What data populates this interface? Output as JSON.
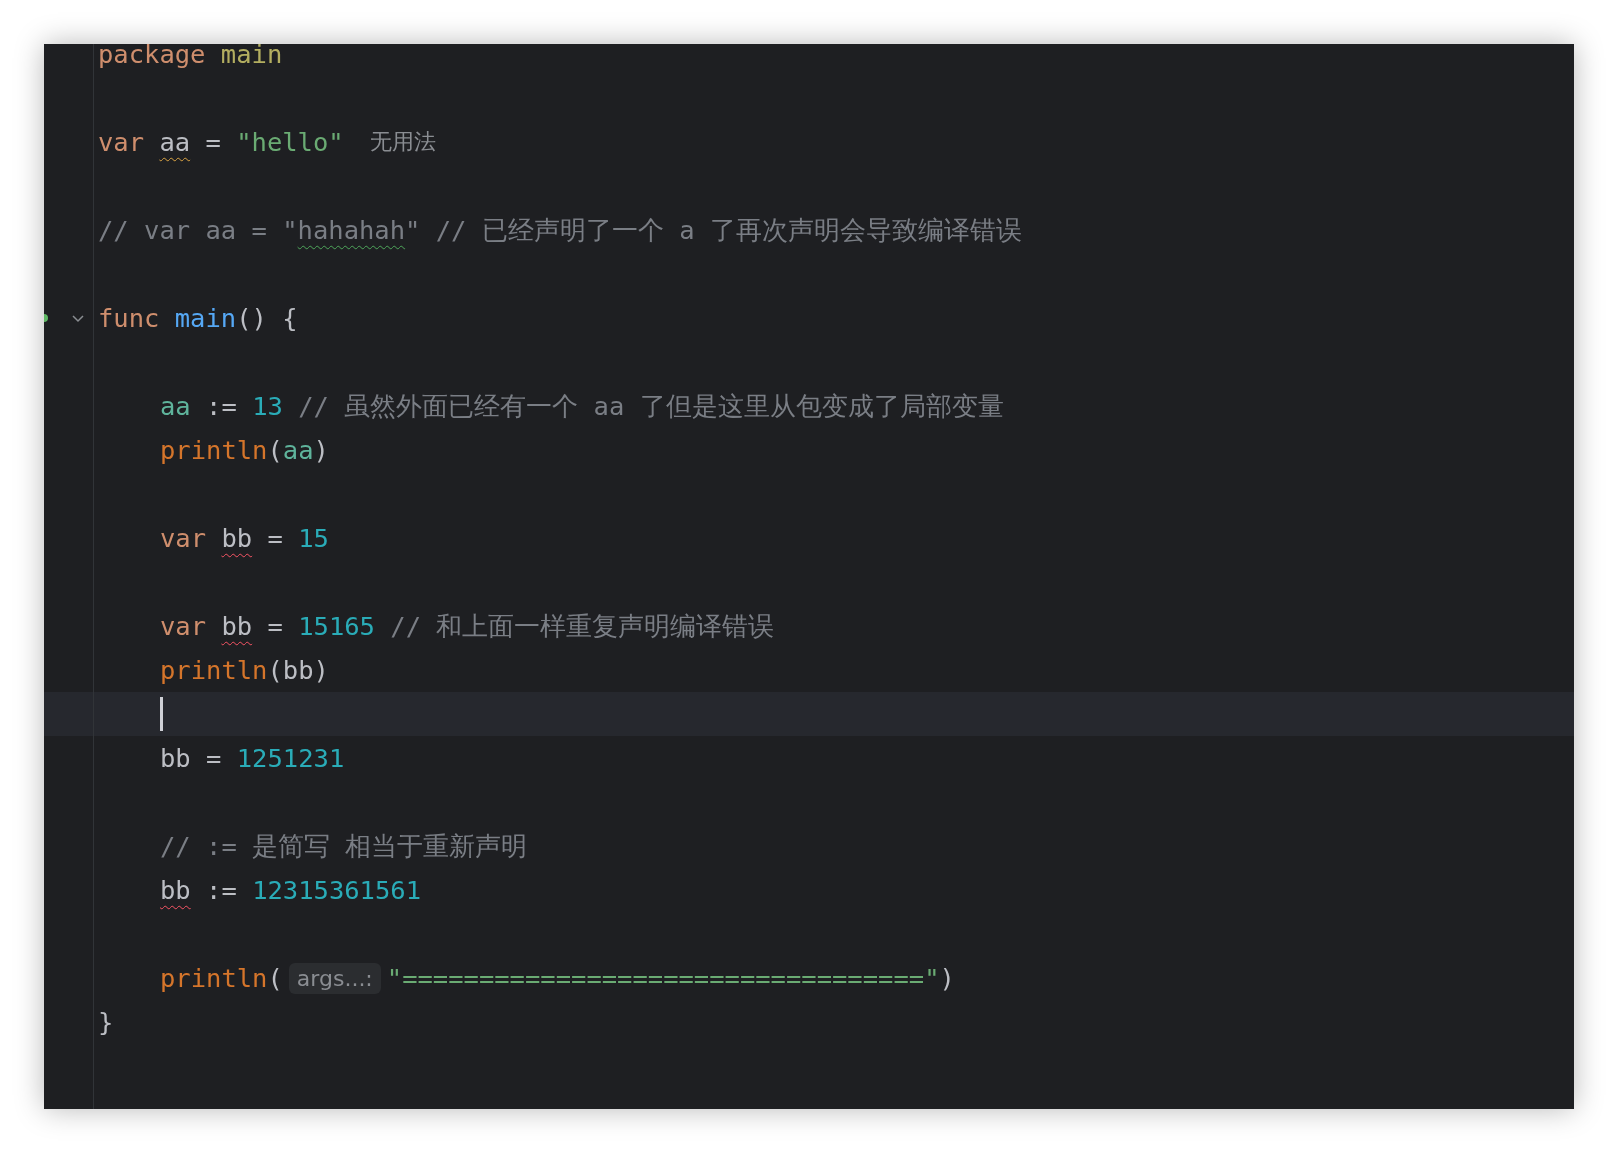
{
  "editor": {
    "lines": [
      {
        "kind": "code",
        "tokens": [
          {
            "text": "package ",
            "kind": "keyword"
          },
          {
            "text": "main",
            "kind": "package"
          }
        ]
      },
      {
        "kind": "blank"
      },
      {
        "kind": "code",
        "tokens": [
          {
            "text": "var ",
            "kind": "keyword"
          },
          {
            "text": "aa",
            "kind": "ident",
            "warning": true
          },
          {
            "text": " = ",
            "kind": "plain"
          },
          {
            "text": "\"hello\"",
            "kind": "string"
          },
          {
            "text": "无用法",
            "kind": "hint"
          }
        ]
      },
      {
        "kind": "blank"
      },
      {
        "kind": "code",
        "tokens": [
          {
            "text": "// var aa = \"",
            "kind": "comment"
          },
          {
            "text": "hahahah",
            "kind": "comment",
            "typo": true
          },
          {
            "text": "\" // 已经声明了一个 a 了再次声明会导致编译错误",
            "kind": "comment"
          }
        ]
      },
      {
        "kind": "blank"
      },
      {
        "kind": "code",
        "foldable": true,
        "run_marker": true,
        "tokens": [
          {
            "text": "func ",
            "kind": "keyword"
          },
          {
            "text": "main",
            "kind": "function"
          },
          {
            "text": "() {",
            "kind": "plain"
          }
        ],
        "children": [
          {
            "kind": "blank"
          },
          {
            "kind": "code",
            "tokens": [
              {
                "text": "aa",
                "kind": "local"
              },
              {
                "text": " := ",
                "kind": "plain"
              },
              {
                "text": "13",
                "kind": "number"
              },
              {
                "text": " // 虽然外面已经有一个 aa 了但是这里从包变成了局部变量",
                "kind": "comment"
              }
            ]
          },
          {
            "kind": "code",
            "tokens": [
              {
                "text": "println",
                "kind": "builtin"
              },
              {
                "text": "(",
                "kind": "plain"
              },
              {
                "text": "aa",
                "kind": "local"
              },
              {
                "text": ")",
                "kind": "plain"
              }
            ]
          },
          {
            "kind": "blank"
          },
          {
            "kind": "code",
            "tokens": [
              {
                "text": "var ",
                "kind": "keyword"
              },
              {
                "text": "bb",
                "kind": "ident",
                "error": true
              },
              {
                "text": " = ",
                "kind": "plain"
              },
              {
                "text": "15",
                "kind": "number"
              }
            ]
          },
          {
            "kind": "blank"
          },
          {
            "kind": "code",
            "tokens": [
              {
                "text": "var ",
                "kind": "keyword"
              },
              {
                "text": "bb",
                "kind": "ident",
                "error": true
              },
              {
                "text": " = ",
                "kind": "plain"
              },
              {
                "text": "15165",
                "kind": "number"
              },
              {
                "text": " // 和上面一样重复声明编译错误",
                "kind": "comment"
              }
            ]
          },
          {
            "kind": "code",
            "tokens": [
              {
                "text": "println",
                "kind": "builtin"
              },
              {
                "text": "(bb)",
                "kind": "plain"
              }
            ]
          },
          {
            "kind": "blank",
            "current": true
          },
          {
            "kind": "code",
            "tokens": [
              {
                "text": "bb = ",
                "kind": "plain"
              },
              {
                "text": "1251231",
                "kind": "number"
              }
            ]
          },
          {
            "kind": "blank"
          },
          {
            "kind": "code",
            "tokens": [
              {
                "text": "// := 是简写 相当于重新声明",
                "kind": "comment"
              }
            ]
          },
          {
            "kind": "code",
            "tokens": [
              {
                "text": "bb",
                "kind": "ident",
                "error": true
              },
              {
                "text": " := ",
                "kind": "plain"
              },
              {
                "text": "12315361561",
                "kind": "number"
              }
            ]
          },
          {
            "kind": "blank"
          },
          {
            "kind": "code",
            "tokens": [
              {
                "text": "println",
                "kind": "builtin"
              },
              {
                "text": "(",
                "kind": "plain"
              },
              {
                "text": "args...:",
                "kind": "param-hint"
              },
              {
                "text": "\"==================================\"",
                "kind": "string"
              },
              {
                "text": ")",
                "kind": "plain"
              }
            ]
          }
        ]
      },
      {
        "kind": "code",
        "tokens": [
          {
            "text": "}",
            "kind": "plain"
          }
        ]
      },
      {
        "kind": "blank"
      }
    ]
  }
}
